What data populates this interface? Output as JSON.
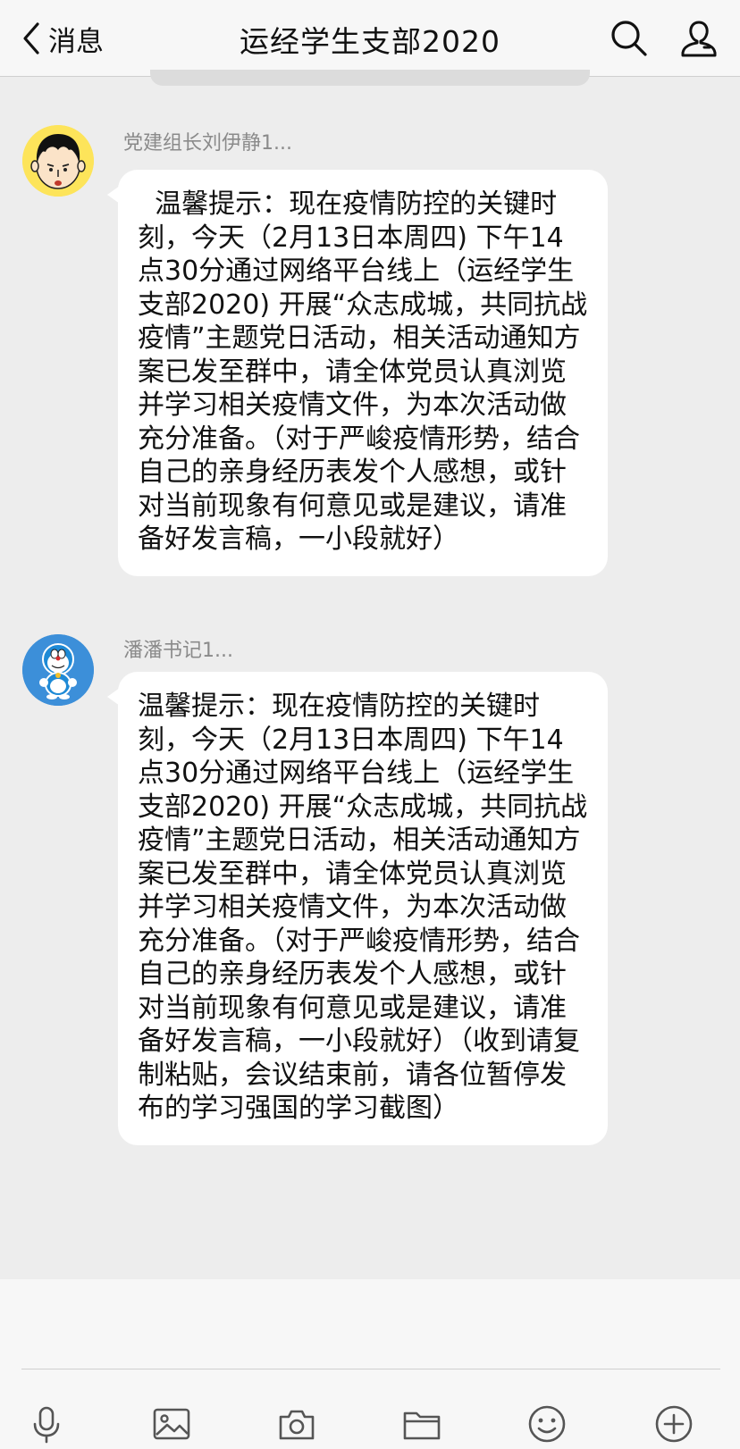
{
  "header": {
    "back_label": "消息",
    "title": "运经学生支部2020",
    "icons": [
      "chevron-left-icon",
      "search-icon",
      "group-members-icon"
    ]
  },
  "messages": [
    {
      "sender": "党建组长刘伊静1...",
      "avatar": "cartoon-boy-avatar",
      "text": "  温馨提示：现在疫情防控的关键时刻，今天（2月13日本周四) 下午14点30分通过网络平台线上（运经学生支部2020) 开展“众志成城，共同抗战疫情”主题党日活动，相关活动通知方案已发至群中，请全体党员认真浏览并学习相关疫情文件，为本次活动做充分准备。（对于严峻疫情形势，结合自己的亲身经历表发个人感想，或针对当前现象有何意见或是建议，请准备好发言稿，一小段就好）"
    },
    {
      "sender": "潘潘书记1...",
      "avatar": "doraemon-avatar",
      "text": "温馨提示：现在疫情防控的关键时刻，今天（2月13日本周四) 下午14点30分通过网络平台线上（运经学生支部2020) 开展“众志成城，共同抗战疫情”主题党日活动，相关活动通知方案已发至群中，请全体党员认真浏览并学习相关疫情文件，为本次活动做充分准备。（对于严峻疫情形势，结合自己的亲身经历表发个人感想，或针对当前现象有何意见或是建议，请准备好发言稿，一小段就好）（收到请复制粘贴，会议结束前，请各位暂停发布的学习强国的学习截图）"
    }
  ],
  "toolbar": {
    "icons": [
      "microphone-icon",
      "image-icon",
      "camera-icon",
      "folder-icon",
      "emoji-icon",
      "plus-icon"
    ]
  },
  "colors": {
    "background": "#ededed",
    "bubble": "#ffffff",
    "header": "#f7f7f7",
    "sender_text": "#8a8a8a"
  }
}
